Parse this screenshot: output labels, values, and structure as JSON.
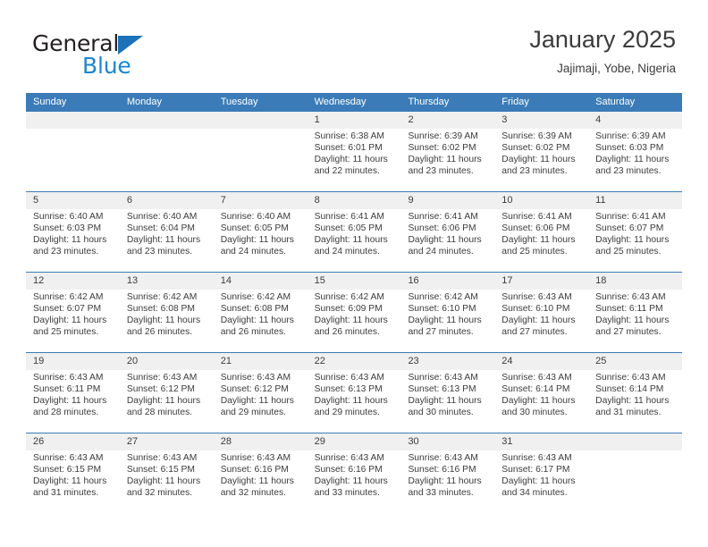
{
  "logo": {
    "word_one": "General",
    "word_two": "Blue",
    "triangle_icon": "triangle-icon",
    "accent_dark": "#231f20",
    "accent_blue": "#1c86d4"
  },
  "header": {
    "title": "January 2025",
    "subtitle": "Jajimaji, Yobe, Nigeria"
  },
  "theme": {
    "header_bg": "#3b7cb8",
    "header_text": "#ffffff",
    "date_strip_bg": "#f0f0f0",
    "body_bg": "#ffffff",
    "text": "#3c3c3c"
  },
  "weekdays": [
    "Sunday",
    "Monday",
    "Tuesday",
    "Wednesday",
    "Thursday",
    "Friday",
    "Saturday"
  ],
  "weeks": [
    {
      "days": [
        {
          "date": "",
          "lines": []
        },
        {
          "date": "",
          "lines": []
        },
        {
          "date": "",
          "lines": []
        },
        {
          "date": "1",
          "lines": [
            "Sunrise: 6:38 AM",
            "Sunset: 6:01 PM",
            "Daylight: 11 hours",
            "and 22 minutes."
          ]
        },
        {
          "date": "2",
          "lines": [
            "Sunrise: 6:39 AM",
            "Sunset: 6:02 PM",
            "Daylight: 11 hours",
            "and 23 minutes."
          ]
        },
        {
          "date": "3",
          "lines": [
            "Sunrise: 6:39 AM",
            "Sunset: 6:02 PM",
            "Daylight: 11 hours",
            "and 23 minutes."
          ]
        },
        {
          "date": "4",
          "lines": [
            "Sunrise: 6:39 AM",
            "Sunset: 6:03 PM",
            "Daylight: 11 hours",
            "and 23 minutes."
          ]
        }
      ]
    },
    {
      "days": [
        {
          "date": "5",
          "lines": [
            "Sunrise: 6:40 AM",
            "Sunset: 6:03 PM",
            "Daylight: 11 hours",
            "and 23 minutes."
          ]
        },
        {
          "date": "6",
          "lines": [
            "Sunrise: 6:40 AM",
            "Sunset: 6:04 PM",
            "Daylight: 11 hours",
            "and 23 minutes."
          ]
        },
        {
          "date": "7",
          "lines": [
            "Sunrise: 6:40 AM",
            "Sunset: 6:05 PM",
            "Daylight: 11 hours",
            "and 24 minutes."
          ]
        },
        {
          "date": "8",
          "lines": [
            "Sunrise: 6:41 AM",
            "Sunset: 6:05 PM",
            "Daylight: 11 hours",
            "and 24 minutes."
          ]
        },
        {
          "date": "9",
          "lines": [
            "Sunrise: 6:41 AM",
            "Sunset: 6:06 PM",
            "Daylight: 11 hours",
            "and 24 minutes."
          ]
        },
        {
          "date": "10",
          "lines": [
            "Sunrise: 6:41 AM",
            "Sunset: 6:06 PM",
            "Daylight: 11 hours",
            "and 25 minutes."
          ]
        },
        {
          "date": "11",
          "lines": [
            "Sunrise: 6:41 AM",
            "Sunset: 6:07 PM",
            "Daylight: 11 hours",
            "and 25 minutes."
          ]
        }
      ]
    },
    {
      "days": [
        {
          "date": "12",
          "lines": [
            "Sunrise: 6:42 AM",
            "Sunset: 6:07 PM",
            "Daylight: 11 hours",
            "and 25 minutes."
          ]
        },
        {
          "date": "13",
          "lines": [
            "Sunrise: 6:42 AM",
            "Sunset: 6:08 PM",
            "Daylight: 11 hours",
            "and 26 minutes."
          ]
        },
        {
          "date": "14",
          "lines": [
            "Sunrise: 6:42 AM",
            "Sunset: 6:08 PM",
            "Daylight: 11 hours",
            "and 26 minutes."
          ]
        },
        {
          "date": "15",
          "lines": [
            "Sunrise: 6:42 AM",
            "Sunset: 6:09 PM",
            "Daylight: 11 hours",
            "and 26 minutes."
          ]
        },
        {
          "date": "16",
          "lines": [
            "Sunrise: 6:42 AM",
            "Sunset: 6:10 PM",
            "Daylight: 11 hours",
            "and 27 minutes."
          ]
        },
        {
          "date": "17",
          "lines": [
            "Sunrise: 6:43 AM",
            "Sunset: 6:10 PM",
            "Daylight: 11 hours",
            "and 27 minutes."
          ]
        },
        {
          "date": "18",
          "lines": [
            "Sunrise: 6:43 AM",
            "Sunset: 6:11 PM",
            "Daylight: 11 hours",
            "and 27 minutes."
          ]
        }
      ]
    },
    {
      "days": [
        {
          "date": "19",
          "lines": [
            "Sunrise: 6:43 AM",
            "Sunset: 6:11 PM",
            "Daylight: 11 hours",
            "and 28 minutes."
          ]
        },
        {
          "date": "20",
          "lines": [
            "Sunrise: 6:43 AM",
            "Sunset: 6:12 PM",
            "Daylight: 11 hours",
            "and 28 minutes."
          ]
        },
        {
          "date": "21",
          "lines": [
            "Sunrise: 6:43 AM",
            "Sunset: 6:12 PM",
            "Daylight: 11 hours",
            "and 29 minutes."
          ]
        },
        {
          "date": "22",
          "lines": [
            "Sunrise: 6:43 AM",
            "Sunset: 6:13 PM",
            "Daylight: 11 hours",
            "and 29 minutes."
          ]
        },
        {
          "date": "23",
          "lines": [
            "Sunrise: 6:43 AM",
            "Sunset: 6:13 PM",
            "Daylight: 11 hours",
            "and 30 minutes."
          ]
        },
        {
          "date": "24",
          "lines": [
            "Sunrise: 6:43 AM",
            "Sunset: 6:14 PM",
            "Daylight: 11 hours",
            "and 30 minutes."
          ]
        },
        {
          "date": "25",
          "lines": [
            "Sunrise: 6:43 AM",
            "Sunset: 6:14 PM",
            "Daylight: 11 hours",
            "and 31 minutes."
          ]
        }
      ]
    },
    {
      "days": [
        {
          "date": "26",
          "lines": [
            "Sunrise: 6:43 AM",
            "Sunset: 6:15 PM",
            "Daylight: 11 hours",
            "and 31 minutes."
          ]
        },
        {
          "date": "27",
          "lines": [
            "Sunrise: 6:43 AM",
            "Sunset: 6:15 PM",
            "Daylight: 11 hours",
            "and 32 minutes."
          ]
        },
        {
          "date": "28",
          "lines": [
            "Sunrise: 6:43 AM",
            "Sunset: 6:16 PM",
            "Daylight: 11 hours",
            "and 32 minutes."
          ]
        },
        {
          "date": "29",
          "lines": [
            "Sunrise: 6:43 AM",
            "Sunset: 6:16 PM",
            "Daylight: 11 hours",
            "and 33 minutes."
          ]
        },
        {
          "date": "30",
          "lines": [
            "Sunrise: 6:43 AM",
            "Sunset: 6:16 PM",
            "Daylight: 11 hours",
            "and 33 minutes."
          ]
        },
        {
          "date": "31",
          "lines": [
            "Sunrise: 6:43 AM",
            "Sunset: 6:17 PM",
            "Daylight: 11 hours",
            "and 34 minutes."
          ]
        },
        {
          "date": "",
          "lines": []
        }
      ]
    }
  ]
}
